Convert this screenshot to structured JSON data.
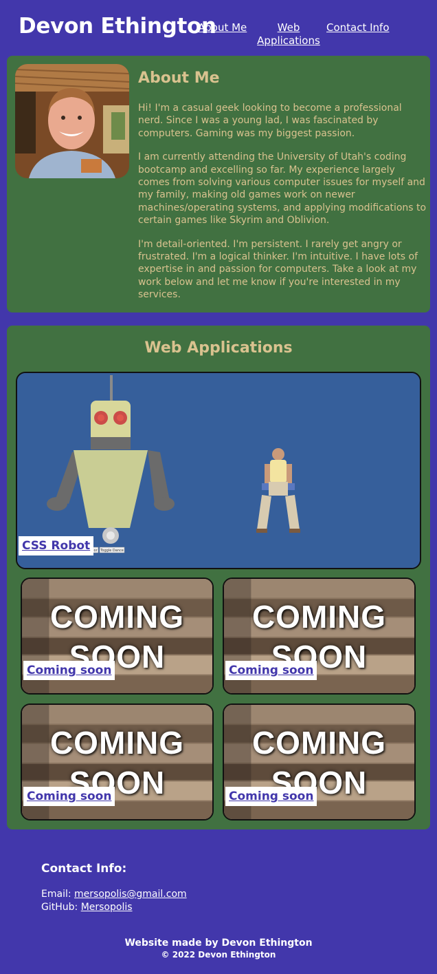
{
  "header": {
    "title": "Devon Ethington",
    "nav": [
      "About Me",
      "Web Applications",
      "Contact Info"
    ]
  },
  "about": {
    "title": "About Me",
    "paragraphs": [
      "Hi! I'm a casual geek looking to become a professional nerd. Since I was a young lad, I was fascinated by computers. Gaming was my biggest passion.",
      "I am currently attending the University of Utah's coding bootcamp and excelling so far. My experience largely comes from solving various computer issues for myself and my family, making old games work on newer machines/operating systems, and applying modifications to certain games like Skyrim and Oblivion.",
      "I'm detail-oriented. I'm persistent. I rarely get angry or frustrated. I'm a logical thinker. I'm intuitive. I have lots of expertise in and passion for computers. Take a look at my work below and let me know if you're interested in my services."
    ]
  },
  "web": {
    "title": "Web Applications",
    "featured": {
      "label": "CSS Robot",
      "buttons": [
        "and color",
        "Toggle Dance"
      ]
    },
    "cards": [
      {
        "label": "Coming soon",
        "image_text": [
          "COMING",
          "SOON"
        ]
      },
      {
        "label": "Coming soon",
        "image_text": [
          "COMING",
          "SOON"
        ]
      },
      {
        "label": "Coming soon",
        "image_text": [
          "COMING",
          "SOON"
        ]
      },
      {
        "label": "Coming soon",
        "image_text": [
          "COMING",
          "SOON"
        ]
      }
    ]
  },
  "contact": {
    "title": "Contact Info:",
    "email_label": "Email:",
    "email": "mersopolis@gmail.com",
    "github_label": "GitHub:",
    "github": "Mersopolis"
  },
  "footer": {
    "made_by": "Website made by Devon Ethington",
    "copyright": "© 2022 Devon Ethington"
  },
  "colors": {
    "background": "#4237ab",
    "panel": "#417141",
    "heading": "#d9c28f",
    "link": "#4237ab"
  }
}
